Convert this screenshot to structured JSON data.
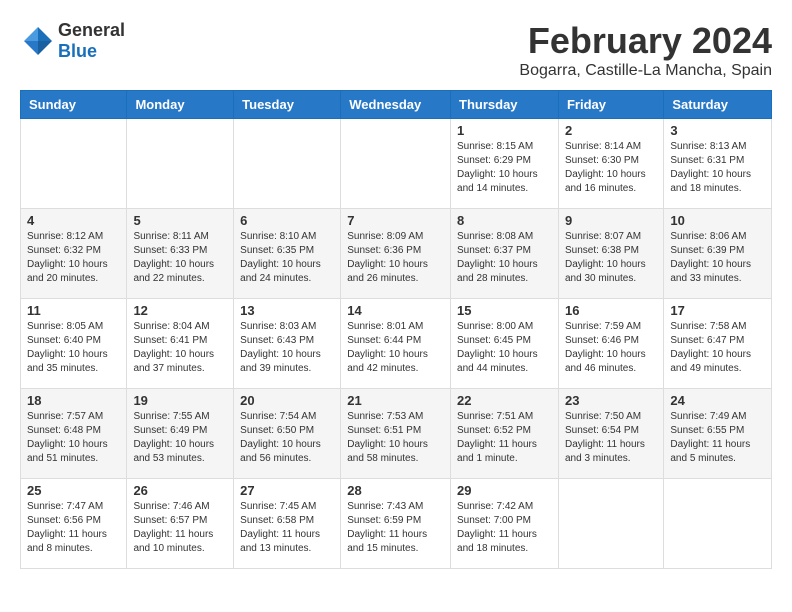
{
  "header": {
    "logo_general": "General",
    "logo_blue": "Blue",
    "month_year": "February 2024",
    "location": "Bogarra, Castille-La Mancha, Spain"
  },
  "calendar": {
    "days_of_week": [
      "Sunday",
      "Monday",
      "Tuesday",
      "Wednesday",
      "Thursday",
      "Friday",
      "Saturday"
    ],
    "weeks": [
      [
        {
          "day": "",
          "info": ""
        },
        {
          "day": "",
          "info": ""
        },
        {
          "day": "",
          "info": ""
        },
        {
          "day": "",
          "info": ""
        },
        {
          "day": "1",
          "info": "Sunrise: 8:15 AM\nSunset: 6:29 PM\nDaylight: 10 hours and 14 minutes."
        },
        {
          "day": "2",
          "info": "Sunrise: 8:14 AM\nSunset: 6:30 PM\nDaylight: 10 hours and 16 minutes."
        },
        {
          "day": "3",
          "info": "Sunrise: 8:13 AM\nSunset: 6:31 PM\nDaylight: 10 hours and 18 minutes."
        }
      ],
      [
        {
          "day": "4",
          "info": "Sunrise: 8:12 AM\nSunset: 6:32 PM\nDaylight: 10 hours and 20 minutes."
        },
        {
          "day": "5",
          "info": "Sunrise: 8:11 AM\nSunset: 6:33 PM\nDaylight: 10 hours and 22 minutes."
        },
        {
          "day": "6",
          "info": "Sunrise: 8:10 AM\nSunset: 6:35 PM\nDaylight: 10 hours and 24 minutes."
        },
        {
          "day": "7",
          "info": "Sunrise: 8:09 AM\nSunset: 6:36 PM\nDaylight: 10 hours and 26 minutes."
        },
        {
          "day": "8",
          "info": "Sunrise: 8:08 AM\nSunset: 6:37 PM\nDaylight: 10 hours and 28 minutes."
        },
        {
          "day": "9",
          "info": "Sunrise: 8:07 AM\nSunset: 6:38 PM\nDaylight: 10 hours and 30 minutes."
        },
        {
          "day": "10",
          "info": "Sunrise: 8:06 AM\nSunset: 6:39 PM\nDaylight: 10 hours and 33 minutes."
        }
      ],
      [
        {
          "day": "11",
          "info": "Sunrise: 8:05 AM\nSunset: 6:40 PM\nDaylight: 10 hours and 35 minutes."
        },
        {
          "day": "12",
          "info": "Sunrise: 8:04 AM\nSunset: 6:41 PM\nDaylight: 10 hours and 37 minutes."
        },
        {
          "day": "13",
          "info": "Sunrise: 8:03 AM\nSunset: 6:43 PM\nDaylight: 10 hours and 39 minutes."
        },
        {
          "day": "14",
          "info": "Sunrise: 8:01 AM\nSunset: 6:44 PM\nDaylight: 10 hours and 42 minutes."
        },
        {
          "day": "15",
          "info": "Sunrise: 8:00 AM\nSunset: 6:45 PM\nDaylight: 10 hours and 44 minutes."
        },
        {
          "day": "16",
          "info": "Sunrise: 7:59 AM\nSunset: 6:46 PM\nDaylight: 10 hours and 46 minutes."
        },
        {
          "day": "17",
          "info": "Sunrise: 7:58 AM\nSunset: 6:47 PM\nDaylight: 10 hours and 49 minutes."
        }
      ],
      [
        {
          "day": "18",
          "info": "Sunrise: 7:57 AM\nSunset: 6:48 PM\nDaylight: 10 hours and 51 minutes."
        },
        {
          "day": "19",
          "info": "Sunrise: 7:55 AM\nSunset: 6:49 PM\nDaylight: 10 hours and 53 minutes."
        },
        {
          "day": "20",
          "info": "Sunrise: 7:54 AM\nSunset: 6:50 PM\nDaylight: 10 hours and 56 minutes."
        },
        {
          "day": "21",
          "info": "Sunrise: 7:53 AM\nSunset: 6:51 PM\nDaylight: 10 hours and 58 minutes."
        },
        {
          "day": "22",
          "info": "Sunrise: 7:51 AM\nSunset: 6:52 PM\nDaylight: 11 hours and 1 minute."
        },
        {
          "day": "23",
          "info": "Sunrise: 7:50 AM\nSunset: 6:54 PM\nDaylight: 11 hours and 3 minutes."
        },
        {
          "day": "24",
          "info": "Sunrise: 7:49 AM\nSunset: 6:55 PM\nDaylight: 11 hours and 5 minutes."
        }
      ],
      [
        {
          "day": "25",
          "info": "Sunrise: 7:47 AM\nSunset: 6:56 PM\nDaylight: 11 hours and 8 minutes."
        },
        {
          "day": "26",
          "info": "Sunrise: 7:46 AM\nSunset: 6:57 PM\nDaylight: 11 hours and 10 minutes."
        },
        {
          "day": "27",
          "info": "Sunrise: 7:45 AM\nSunset: 6:58 PM\nDaylight: 11 hours and 13 minutes."
        },
        {
          "day": "28",
          "info": "Sunrise: 7:43 AM\nSunset: 6:59 PM\nDaylight: 11 hours and 15 minutes."
        },
        {
          "day": "29",
          "info": "Sunrise: 7:42 AM\nSunset: 7:00 PM\nDaylight: 11 hours and 18 minutes."
        },
        {
          "day": "",
          "info": ""
        },
        {
          "day": "",
          "info": ""
        }
      ]
    ]
  }
}
